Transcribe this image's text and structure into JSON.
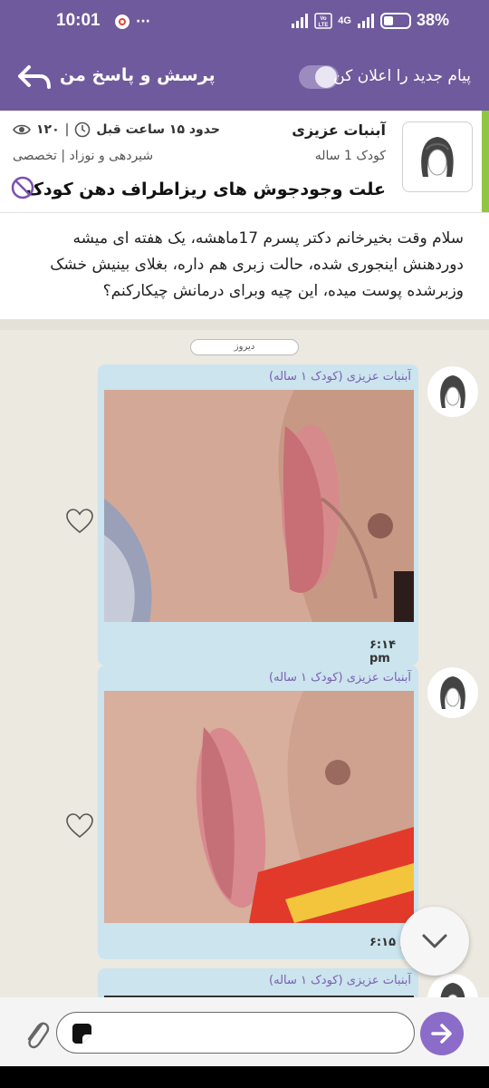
{
  "status_bar": {
    "time": "10:01",
    "more": "···",
    "network": "4G",
    "battery_percent": "38%",
    "battery_level": 0.38
  },
  "header": {
    "title": "پرسش و پاسخ من",
    "notify_label": "پیام جدید را اعلان کن",
    "notify_enabled": true
  },
  "question": {
    "author_name": "آبنبات عزیزی",
    "author_sub": "کودک 1 ساله",
    "time_ago": "حدود ۱۵ ساعت قبل",
    "views": "۱۲۰",
    "separator": "|",
    "category": "شیردهی و نوزاد | تخصصی",
    "title": "علت وجودجوش های ریزاطراف دهن کودک",
    "body": "سلام وقت بخیرخانم دکتر پسرم 17ماهشه، یک هفته ای میشه دوردهنش اینجوری شده، حالت زبری هم داره، بغلای بینیش خشک وزبرشده پوست میده، این چیه وبرای درمانش چیکارکنم؟"
  },
  "chat": {
    "date_chip": "دیروز",
    "messages": [
      {
        "sender": "آبنبات عزیزی (کودک ۱ ساله)",
        "time": "۶:۱۴ pm"
      },
      {
        "sender": "آبنبات عزیزی (کودک ۱ ساله)",
        "time": "۶:۱۵ p"
      },
      {
        "sender": "آبنبات عزیزی (کودک ۱ ساله)",
        "time": ""
      }
    ]
  },
  "composer": {
    "placeholder": ""
  },
  "colors": {
    "primary": "#6e5a9c",
    "accent_green": "#8fc740",
    "bubble": "#cbe4ee",
    "send": "#8b6cc9"
  }
}
